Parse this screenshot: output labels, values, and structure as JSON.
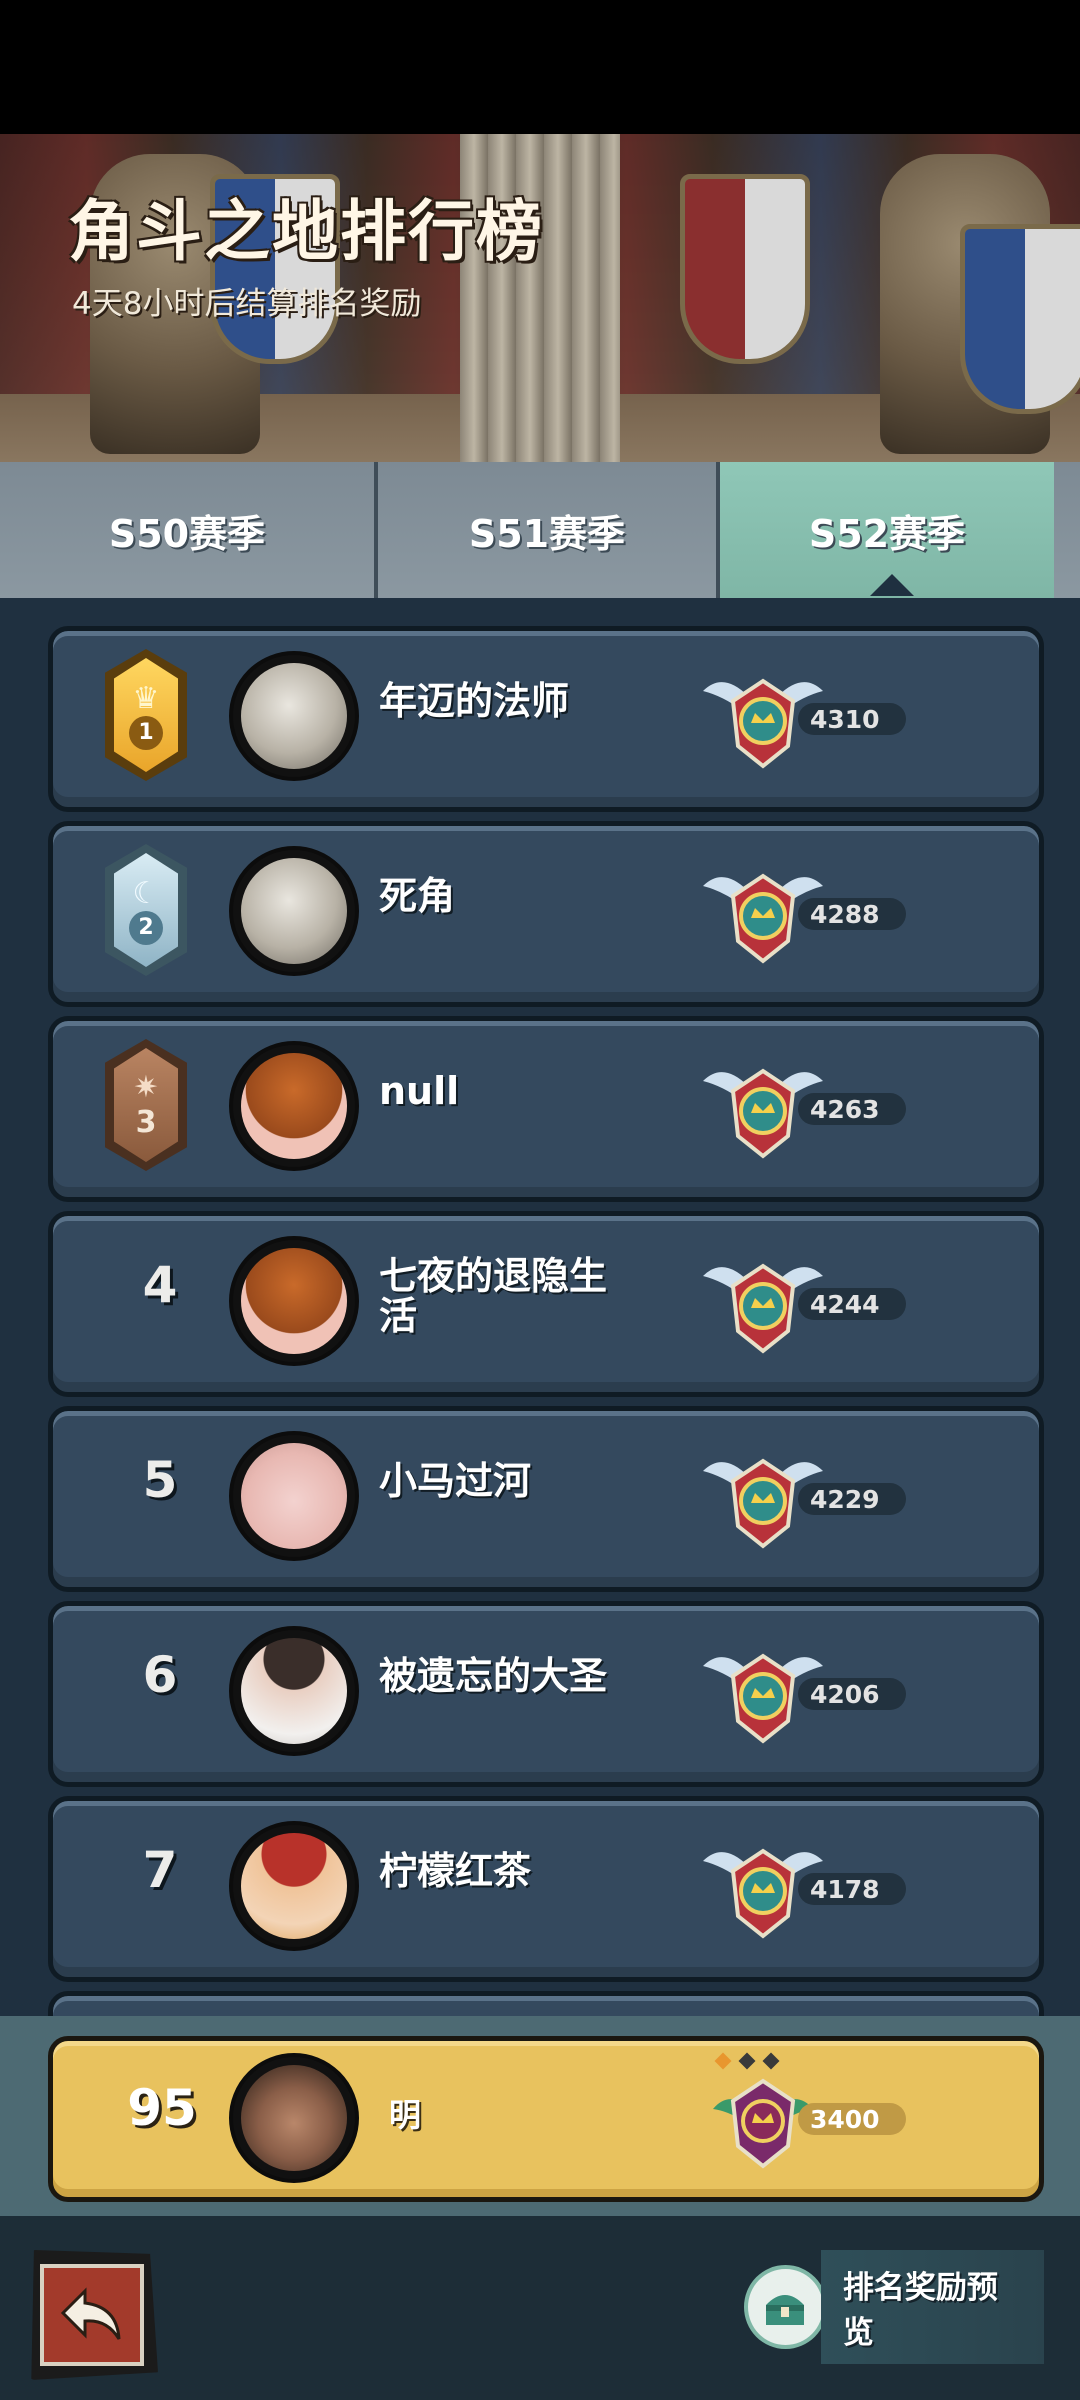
{
  "header": {
    "title": "角斗之地排行榜",
    "subtitle": "4天8小时后结算排名奖励"
  },
  "tabs": [
    {
      "label": "S50赛季",
      "active": false
    },
    {
      "label": "S51赛季",
      "active": false
    },
    {
      "label": "S52赛季",
      "active": true
    }
  ],
  "leaderboard": [
    {
      "rank": "1",
      "name": "年迈的法师",
      "score": "4310",
      "badge": "gold-crown-badge"
    },
    {
      "rank": "2",
      "name": "死角",
      "score": "4288",
      "badge": "silver-moon-badge"
    },
    {
      "rank": "3",
      "name": "null",
      "score": "4263",
      "badge": "bronze-star-badge"
    },
    {
      "rank": "4",
      "name": "七夜的退隐生活",
      "score": "4244"
    },
    {
      "rank": "5",
      "name": "小马过河",
      "score": "4229"
    },
    {
      "rank": "6",
      "name": "被遗忘的大圣",
      "score": "4206"
    },
    {
      "rank": "7",
      "name": "柠檬红茶",
      "score": "4178"
    }
  ],
  "my_rank": {
    "rank": "95",
    "name": "明",
    "score": "3400"
  },
  "footer": {
    "reward_preview_label": "排名奖励预览",
    "back_icon": "back-arrow-icon"
  },
  "colors": {
    "row_bg": "#34495e",
    "my_row_bg": "#e8c25e",
    "active_tab": "#8fc7b7",
    "gold": "#f0b93a",
    "silver": "#a9c7d6",
    "bronze": "#9b6a47"
  }
}
